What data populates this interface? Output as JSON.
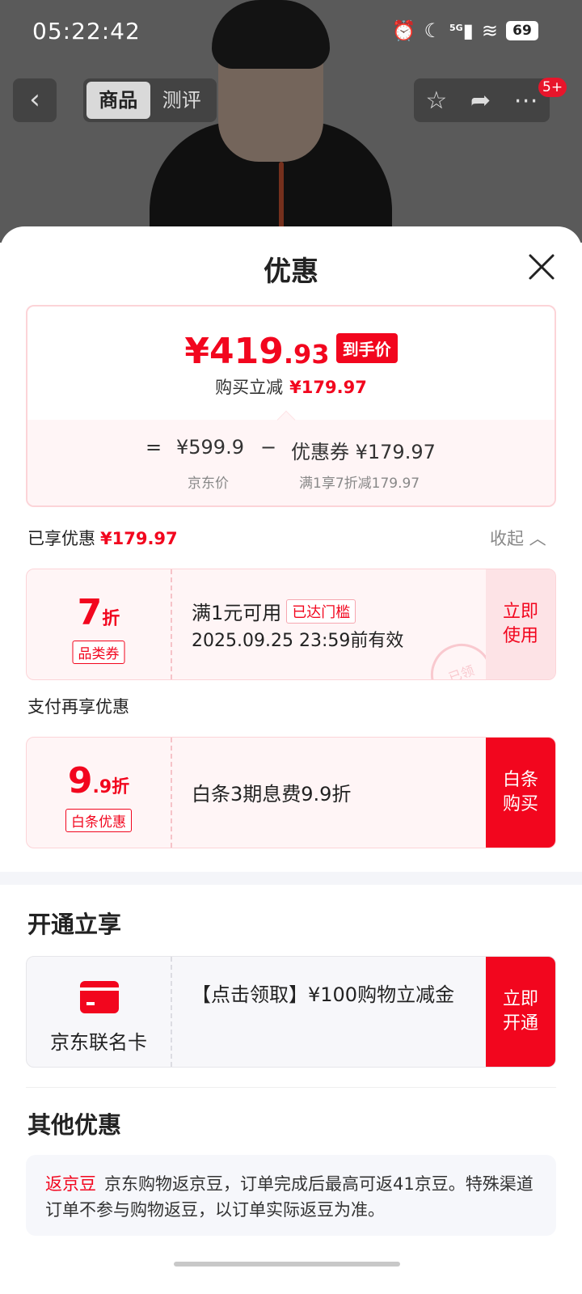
{
  "status_bar": {
    "time": "05:22:42",
    "network": "5G",
    "battery": "69"
  },
  "header": {
    "tabs": [
      "商品",
      "测评"
    ],
    "active_tab": "商品",
    "badge": "5+"
  },
  "sheet": {
    "title": "优惠",
    "price": {
      "currency": "¥",
      "integer": "419",
      "decimal": ".93",
      "tag": "到手价",
      "sub_label": "购买立减",
      "sub_value": "¥179.97"
    },
    "formula": {
      "equals": "=",
      "base": "¥599.9",
      "minus": "−",
      "coupon": "优惠券 ¥179.97",
      "base_label": "京东价",
      "coupon_label": "满1享7折减179.97"
    },
    "enjoyed": {
      "label": "已享优惠",
      "value": "¥179.97",
      "collapse": "收起 ︿"
    },
    "coupon1": {
      "value_big": "7",
      "value_small": "折",
      "type": "品类券",
      "line1": "满1元可用",
      "threshold": "已达门槛",
      "line2": "2025.09.25 23:59前有效",
      "action": "立即使用",
      "stamp": "已领"
    },
    "pay_section": "支付再享优惠",
    "coupon2": {
      "value_big": "9",
      "value_small": ".9折",
      "type": "白条优惠",
      "line1": "白条3期息费9.9折",
      "action": "白条购买"
    },
    "open_section": "开通立享",
    "card": {
      "name": "京东联名卡",
      "text": "【点击领取】¥100购物立减金",
      "action": "立即开通"
    },
    "other_section": "其他优惠",
    "other": {
      "tag": "返京豆",
      "text": "京东购物返京豆，订单完成后最高可返41京豆。特殊渠道订单不参与购物返豆，以订单实际返豆为准。"
    }
  },
  "colors": {
    "brand_red": "#f2061e",
    "light_pink": "#fff5f6"
  }
}
